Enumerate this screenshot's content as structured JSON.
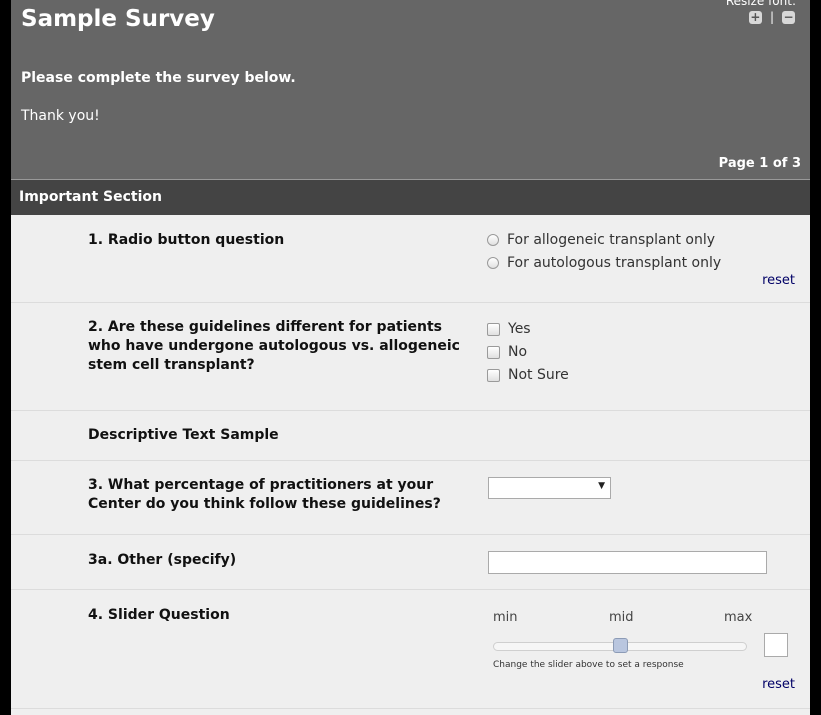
{
  "survey": {
    "title": "Sample Survey",
    "resize_font_label": "Resize font:",
    "resize_increase_symbol": "+",
    "resize_separator": "|",
    "resize_decrease_symbol": "−",
    "intro_bold": "Please complete the survey below.",
    "intro_thanks": "Thank you!",
    "page_indicator": "Page 1 of 3"
  },
  "section": {
    "title": "Important Section"
  },
  "questions": {
    "q1": {
      "label": "1. Radio button question",
      "options": [
        "For allogeneic transplant only",
        "For autologous transplant only"
      ],
      "reset": "reset"
    },
    "q2": {
      "label": "2. Are these guidelines different for patients who have undergone autologous vs. allogeneic stem cell transplant?",
      "options": [
        "Yes",
        "No",
        "Not Sure"
      ]
    },
    "descriptive": {
      "text": "Descriptive Text Sample"
    },
    "q3": {
      "label": "3. What percentage of practitioners at your Center do you think follow these guidelines?",
      "selected": "",
      "arrow": "▼"
    },
    "q3a": {
      "label": "3a. Other (specify)",
      "value": ""
    },
    "q4": {
      "label": "4. Slider Question",
      "min_label": "min",
      "mid_label": "mid",
      "max_label": "max",
      "slider_position": 0.5,
      "help": "Change the slider above to set a response",
      "value": "",
      "reset": "reset"
    }
  },
  "colors": {
    "header_bg": "#666666",
    "section_bg": "#444444",
    "page_bg": "#efefef",
    "link": "#000066"
  }
}
